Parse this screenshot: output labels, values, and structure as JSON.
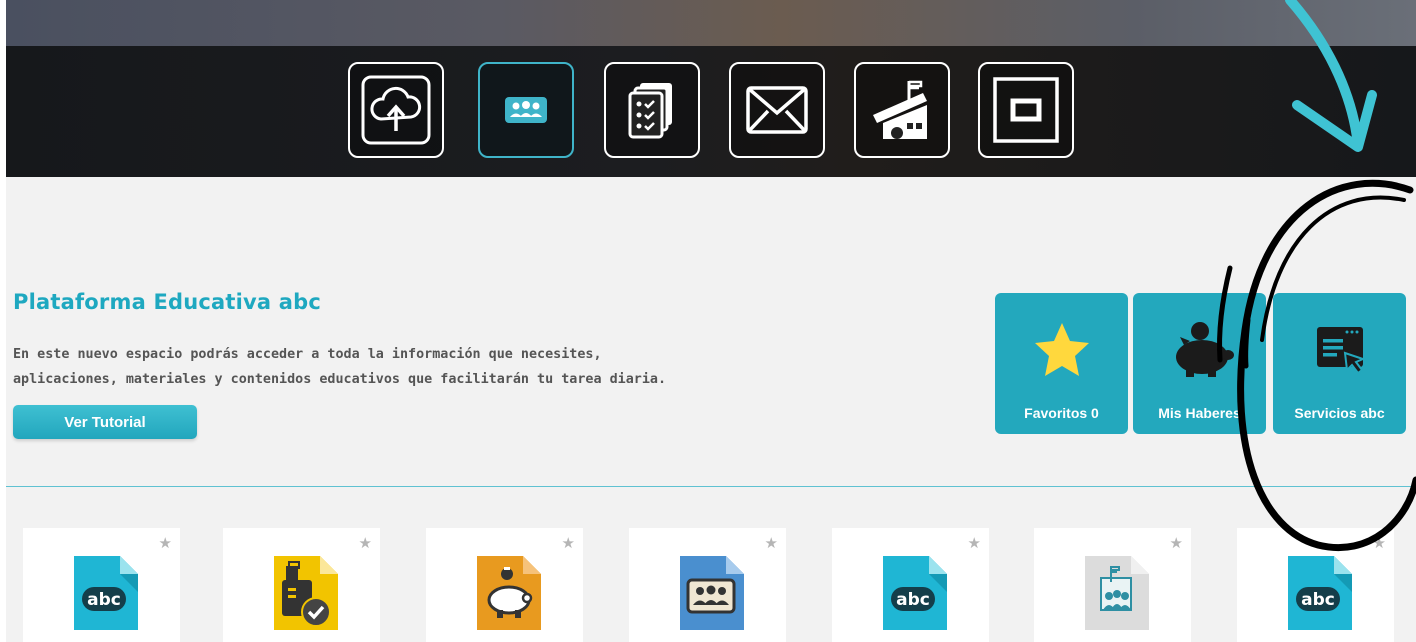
{
  "nav_icons": [
    {
      "name": "cloud-upload-icon",
      "active": false
    },
    {
      "name": "people-card-icon",
      "active": true
    },
    {
      "name": "checklist-icon",
      "active": false
    },
    {
      "name": "mail-icon",
      "active": false
    },
    {
      "name": "school-icon",
      "active": false
    },
    {
      "name": "square-icon",
      "active": false
    }
  ],
  "main": {
    "title": "Plataforma Educativa abc",
    "description_line1": "En este nuevo espacio podrás acceder a toda la información que necesites,",
    "description_line2": "aplicaciones, materiales y contenidos educativos que facilitarán tu tarea diaria.",
    "tutorial_button": "Ver Tutorial"
  },
  "quick_tiles": [
    {
      "label": "Favoritos 0",
      "icon": "star-icon"
    },
    {
      "label": "Mis Haberes",
      "icon": "piggy-bank-icon"
    },
    {
      "label": "Servicios abc",
      "icon": "browser-window-icon"
    }
  ],
  "apps": [
    {
      "icon": "abc-doc-icon",
      "color": "#1fb6d4",
      "text": "abc"
    },
    {
      "icon": "id-badge-check-icon",
      "color": "#f2c400"
    },
    {
      "icon": "piggy-bank-doc-icon",
      "color": "#e89a1f"
    },
    {
      "icon": "people-card-doc-icon",
      "color": "#4a8fcf"
    },
    {
      "icon": "abc-doc-icon",
      "color": "#1fb6d4",
      "text": "abc"
    },
    {
      "icon": "school-people-doc-icon",
      "color": "#dcdcdc"
    },
    {
      "icon": "abc-doc-icon",
      "color": "#1fb6d4",
      "text": "abc"
    }
  ],
  "colors": {
    "accent": "#23a8bd",
    "title": "#1ea8c0",
    "annotation_arrow": "#3fc3d3"
  }
}
